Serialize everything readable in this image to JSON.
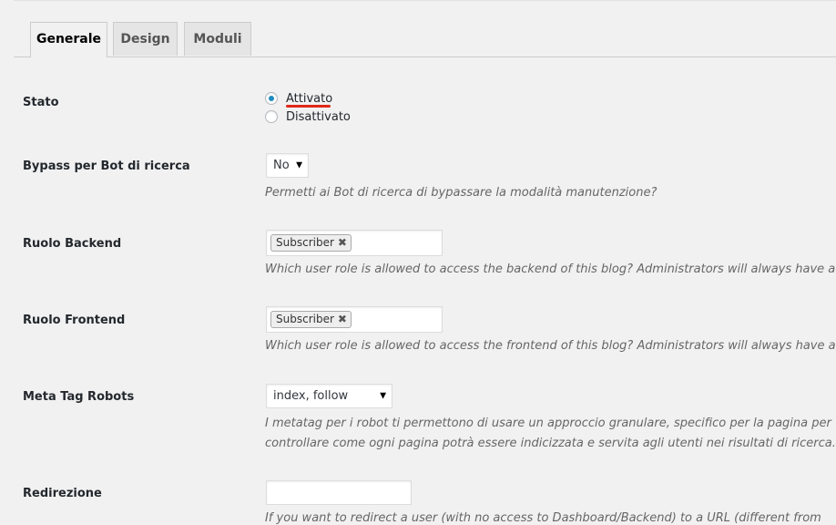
{
  "tabs": [
    {
      "label": "Generale",
      "active": true
    },
    {
      "label": "Design",
      "active": false
    },
    {
      "label": "Moduli",
      "active": false
    }
  ],
  "stato": {
    "label": "Stato",
    "options": [
      "Attivato",
      "Disattivato"
    ],
    "selected": "Attivato"
  },
  "bypass": {
    "label": "Bypass per Bot di ricerca",
    "value": "No",
    "description": "Permetti ai Bot di ricerca di bypassare la modalità manutenzione?"
  },
  "ruolo_backend": {
    "label": "Ruolo Backend",
    "token": "Subscriber",
    "description": "Which user role is allowed to access the backend of this blog? Administrators will always have access."
  },
  "ruolo_frontend": {
    "label": "Ruolo Frontend",
    "token": "Subscriber",
    "description": "Which user role is allowed to access the frontend of this blog? Administrators will always have access."
  },
  "meta_robots": {
    "label": "Meta Tag Robots",
    "value": "index, follow",
    "description_line1": "I metatag per i robot ti permettono di usare un approccio granulare, specifico per la pagina per",
    "description_line2": "controllare come ogni pagina potrà essere indicizzata e servita agli utenti nei risultati di ricerca."
  },
  "redirezione": {
    "label": "Redirezione",
    "value": "",
    "description": "If you want to redirect a user (with no access to Dashboard/Backend) to a URL (different from"
  },
  "icons": {
    "dropdown": "▼",
    "remove": "✖"
  },
  "colors": {
    "accent": "#1e8cbe",
    "highlight_underline": "#e0271a"
  }
}
